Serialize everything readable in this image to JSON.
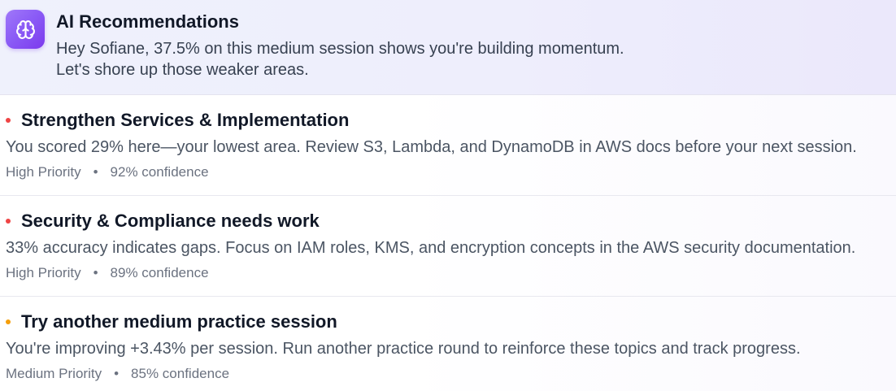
{
  "header": {
    "icon": "brain-icon",
    "title": "AI Recommendations",
    "message": "Hey Sofiane, 37.5% on this medium session shows you're building momentum. Let's shore up those weaker areas."
  },
  "meta_separator": "•",
  "colors": {
    "accent": "#8b5cf6",
    "high_priority": "#ef4444",
    "medium_priority": "#f59e0b"
  },
  "recommendations": [
    {
      "title": "Strengthen Services & Implementation",
      "description": "You scored 29% here—your lowest area. Review S3, Lambda, and DynamoDB in AWS docs before your next session.",
      "priority": "High Priority",
      "confidence": "92% confidence",
      "dot_color": "#ef4444"
    },
    {
      "title": "Security & Compliance needs work",
      "description": "33% accuracy indicates gaps. Focus on IAM roles, KMS, and encryption concepts in the AWS security documentation.",
      "priority": "High Priority",
      "confidence": "89% confidence",
      "dot_color": "#ef4444"
    },
    {
      "title": "Try another medium practice session",
      "description": "You're improving +3.43% per session. Run another practice round to reinforce these topics and track progress.",
      "priority": "Medium Priority",
      "confidence": "85% confidence",
      "dot_color": "#f59e0b"
    }
  ]
}
